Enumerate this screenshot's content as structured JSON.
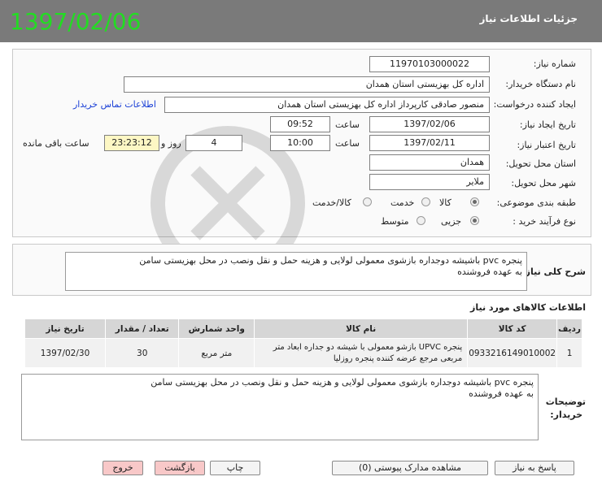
{
  "header": {
    "title": "جزئیات اطلاعات نیاز",
    "date_stamp": "1397/02/06"
  },
  "form": {
    "need_number": {
      "label": "شماره نیاز:",
      "value": "1197010300002​2"
    },
    "buyer_org": {
      "label": "نام دستگاه خریدار:",
      "value": "اداره کل بهزیستی استان همدان"
    },
    "requester": {
      "label": "ایجاد کننده درخواست:",
      "value": "منصور صادقی کارپرداز اداره کل بهزیستی استان همدان",
      "contact_link": "اطلاعات تماس خریدار"
    },
    "created": {
      "label": "تاریخ ایجاد نیاز:",
      "date": "1397/02/06",
      "time_label": "ساعت",
      "time": "09:52"
    },
    "validity": {
      "label": "تاریخ اعتبار نیاز:",
      "date": "1397/02/11",
      "time_label": "ساعت",
      "time": "10:00",
      "days": "4",
      "days_label": "روز و",
      "remaining": "23:23:12",
      "remaining_label": "ساعت باقی مانده"
    },
    "province": {
      "label": "استان محل تحویل:",
      "value": "همدان"
    },
    "city": {
      "label": "شهر محل تحویل:",
      "value": "ملایر"
    },
    "category": {
      "label": "طبقه بندی موضوعی:",
      "options": [
        "کالا",
        "خدمت",
        "کالا/خدمت"
      ],
      "selected": 0
    },
    "process": {
      "label": "نوع فرآیند خرید :",
      "options": [
        "جزیی",
        "متوسط"
      ],
      "selected": 0
    }
  },
  "summary": {
    "label": "شرح کلی نیاز:",
    "line1": "پنجره pvc باشیشه دوجداره بازشوی معمولی لولایی و هزینه حمل و نقل ونصب در محل بهزیستی سامن",
    "line2": "به عهده فروشنده"
  },
  "goods": {
    "title": "اطلاعات کالاهای مورد نیاز",
    "headers": {
      "row": "ردیف",
      "code": "کد کالا",
      "name": "نام کالا",
      "unit": "واحد شمارش",
      "qty": "تعداد / مقدار",
      "date": "تاریخ نیاز"
    },
    "rows": [
      {
        "row": "1",
        "code": "0933216149010002",
        "name1": "پنجره UPVC بازشو معمولی با شیشه دو جداره ابعاد متر",
        "name2": "مربعی مرجع عرضه کننده پنجره روزلیا",
        "unit": "متر مربع",
        "qty": "30",
        "date": "1397/02/30"
      }
    ]
  },
  "buyer_notes": {
    "label1": "توضیحات",
    "label2": "خریدار:",
    "line1": "پنجره pvc باشیشه دوجداره بازشوی معمولی لولایی و هزینه حمل و نقل ونصب در محل بهزیستی سامن",
    "line2": "به عهده فروشنده"
  },
  "buttons": {
    "reply": "پاسخ به نیاز",
    "attachments": "مشاهده مدارک پیوستی (0)",
    "print": "چاپ",
    "back": "بازگشت",
    "exit": "خروج"
  }
}
